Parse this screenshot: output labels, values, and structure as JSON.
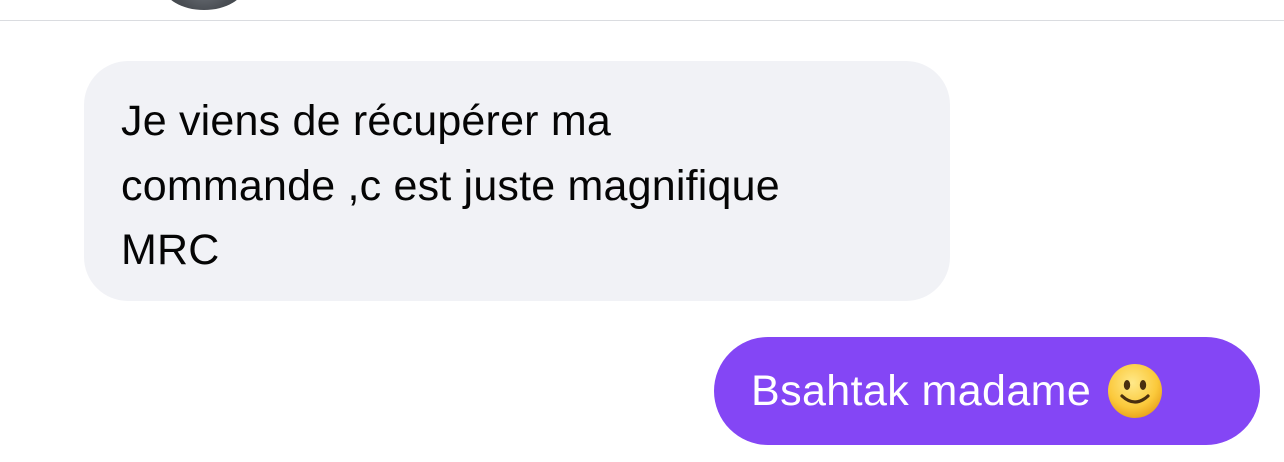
{
  "conversation": {
    "messages": [
      {
        "direction": "incoming",
        "lines": [
          "Je viens de récupérer ma",
          "commande ,c est juste magnifique",
          "MRC"
        ]
      },
      {
        "direction": "outgoing",
        "text": "Bsahtak madame",
        "emoji": "slightly-smiling-face-icon"
      }
    ]
  },
  "colors": {
    "incoming_bubble": "#f1f2f6",
    "outgoing_bubble": "#8446f5",
    "incoming_text": "#050505",
    "outgoing_text": "#ffffff",
    "divider": "#dadce0"
  }
}
